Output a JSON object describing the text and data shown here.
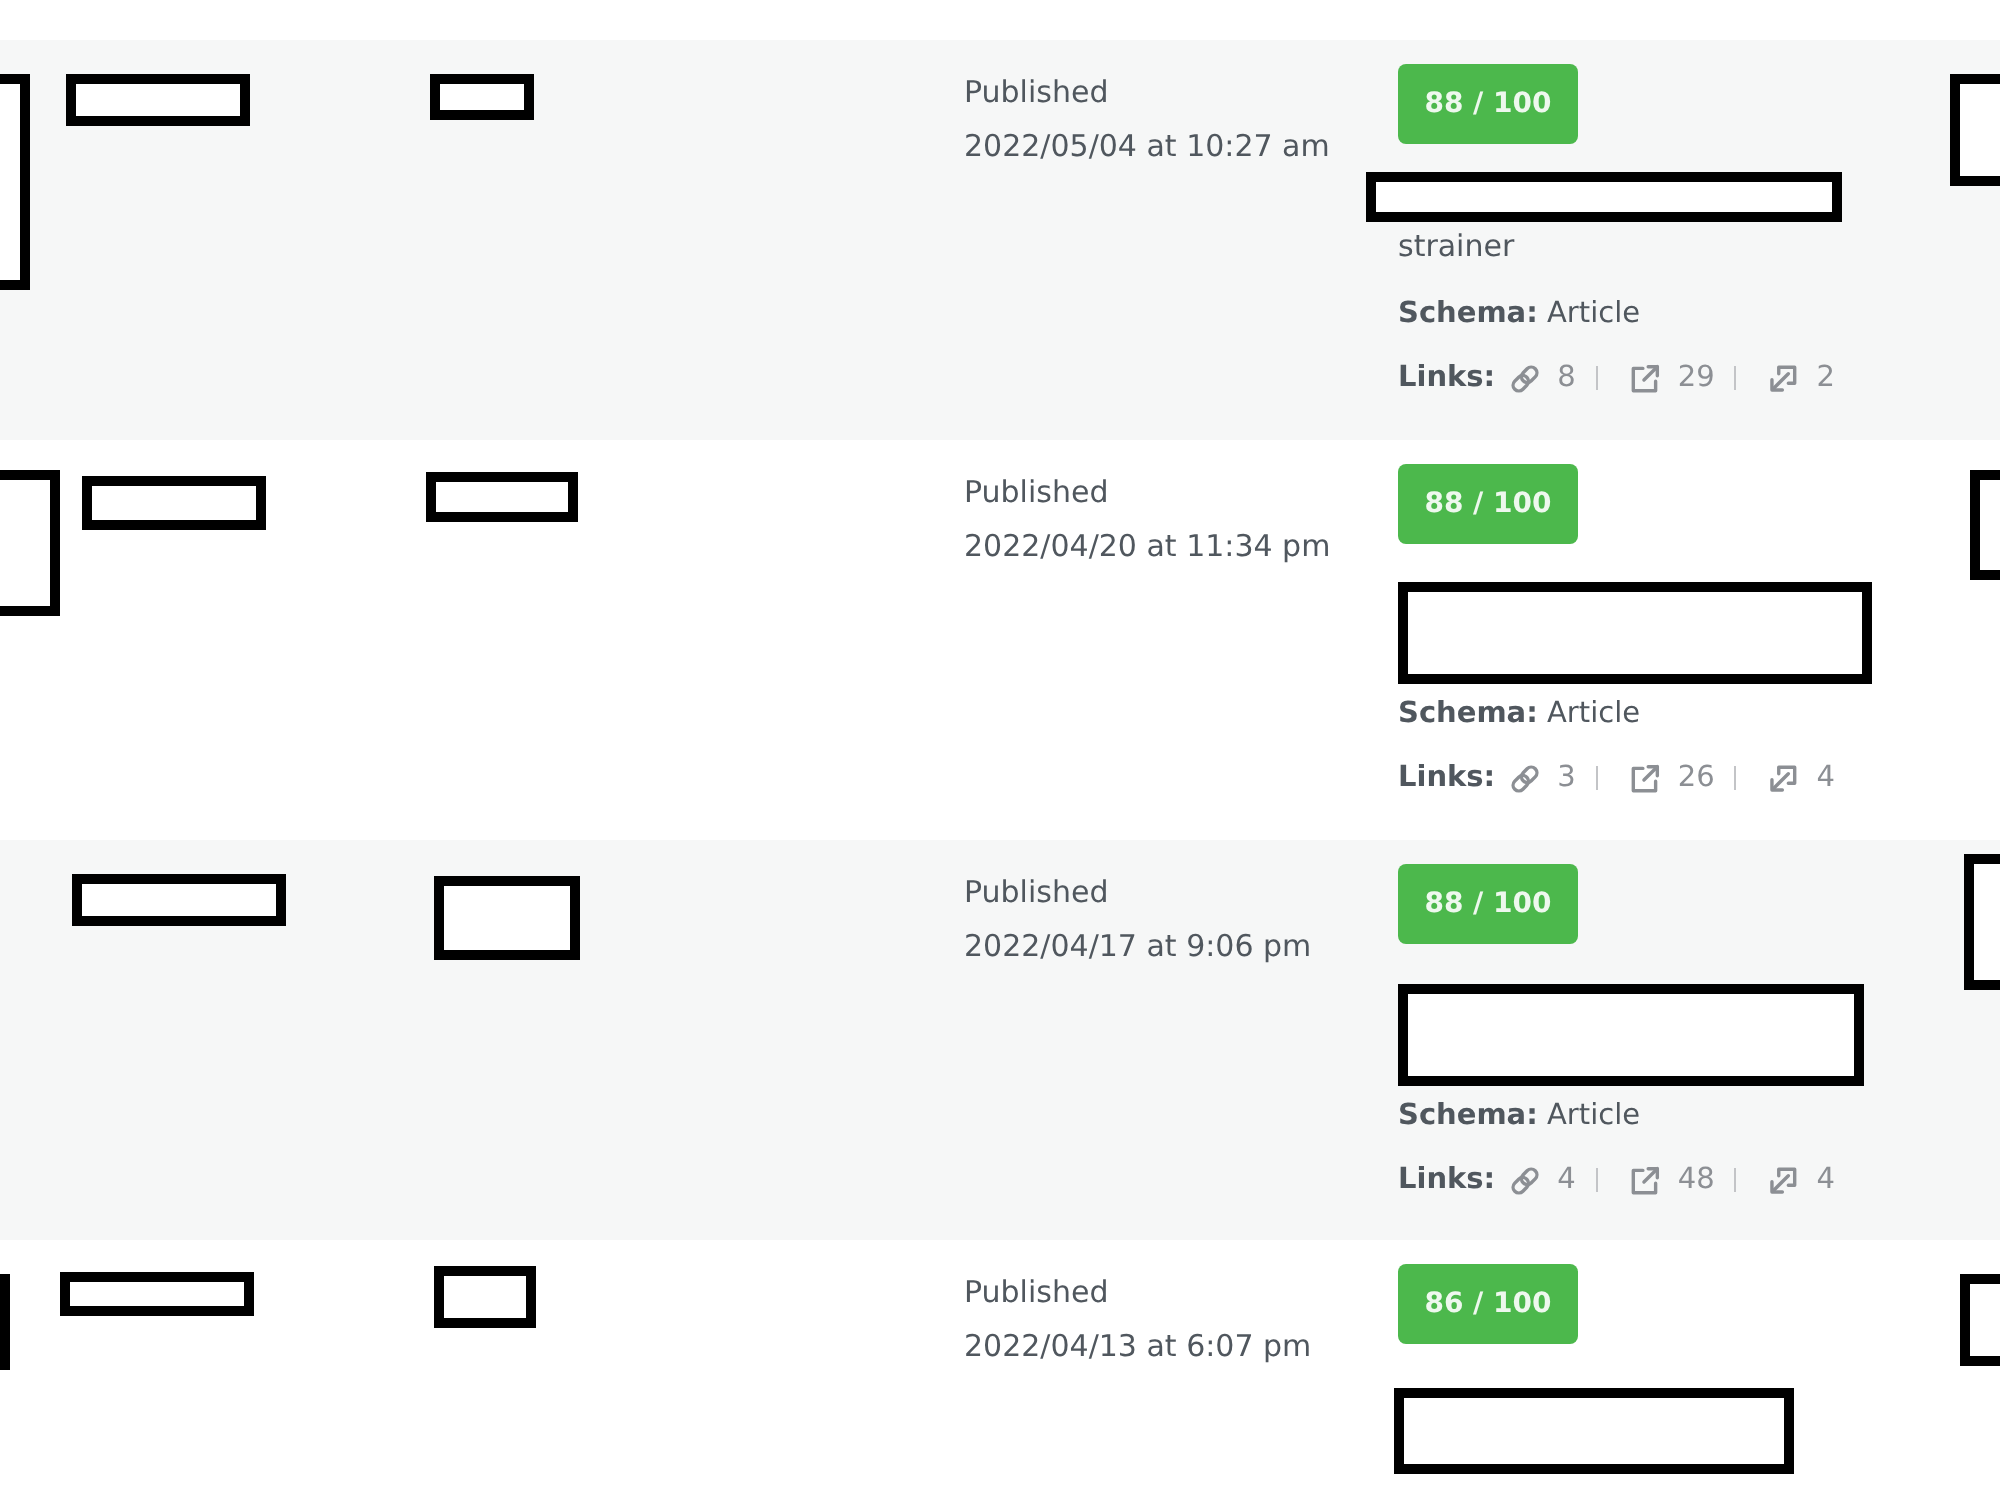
{
  "posts": [
    {
      "status": "Published",
      "date": "2022/05/04 at 10:27 am",
      "seo_score": "88 / 100",
      "keyword_tail": "strainer",
      "schema": "**Schema:** Article",
      "links": {
        "label": "Links:",
        "internal": "8",
        "external": "29",
        "incoming": "2"
      }
    },
    {
      "status": "Published",
      "date": "2022/04/20 at 11:34 pm",
      "seo_score": "88 / 100",
      "schema": "**Schema:** Article",
      "links": {
        "label": "Links:",
        "internal": "3",
        "external": "26",
        "incoming": "4"
      }
    },
    {
      "status": "Published",
      "date": "2022/04/17 at 9:06 pm",
      "seo_score": "88 / 100",
      "schema": "**Schema:** Article",
      "links": {
        "label": "Links:",
        "internal": "4",
        "external": "48",
        "incoming": "4"
      }
    },
    {
      "status": "Published",
      "date": "2022/04/13 at 6:07 pm",
      "seo_score": "86 / 100"
    }
  ]
}
